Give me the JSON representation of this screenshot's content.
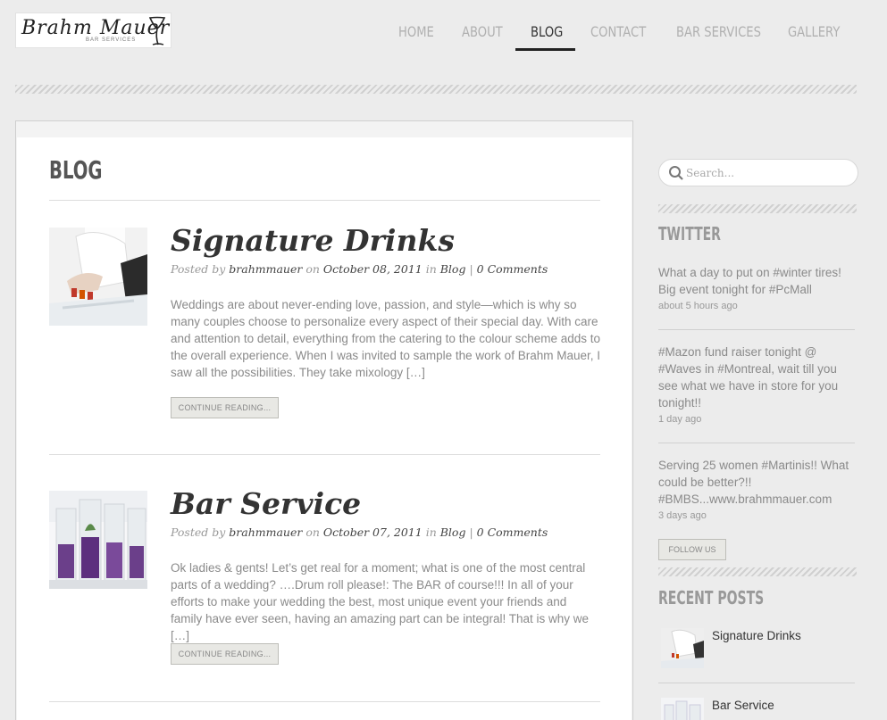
{
  "logo": {
    "script": "Brahm Mauer",
    "sub": "BAR SERVICES"
  },
  "nav": {
    "items": [
      {
        "label": "Home"
      },
      {
        "label": "About"
      },
      {
        "label": "Blog"
      },
      {
        "label": "Contact"
      },
      {
        "label": "Bar Services"
      },
      {
        "label": "Gallery"
      }
    ],
    "active": "Blog"
  },
  "page": {
    "title": "BLOG"
  },
  "posts": [
    {
      "title": "Signature Drinks",
      "meta": {
        "posted_by": "Posted by",
        "author": "brahmmauer",
        "on": "on",
        "date": "October 08, 2011",
        "in": "in",
        "category": "Blog",
        "sep": "|",
        "comments": "0 Comments"
      },
      "excerpt": "Weddings are about never-ending love, passion, and style—which is why so many couples choose to personalize every aspect of their special day.  With care and attention to detail, everything from the catering to the colour scheme adds to the overall experience. When I was invited to sample the work of Brahm Mauer, I saw all the possibilities. They take mixology […]",
      "button": "Continue Reading..."
    },
    {
      "title": "Bar Service",
      "meta": {
        "posted_by": "Posted by",
        "author": "brahmmauer",
        "on": "on",
        "date": "October 07, 2011",
        "in": "in",
        "category": "Blog",
        "sep": "|",
        "comments": "0 Comments"
      },
      "excerpt": "Ok ladies & gents! Let’s get real for a moment; what is one of the most central parts of a wedding? ….Drum roll please!: The BAR of course!!! In all of your efforts to make your wedding the best, most unique event your friends and family have ever seen, having an amazing part can be integral! That is why we […]",
      "button": "Continue Reading..."
    }
  ],
  "sidebar": {
    "search": {
      "placeholder": "Search..."
    },
    "twitter": {
      "heading": "Twitter",
      "tweets": [
        {
          "text": "What a day to put on #winter tires! Big event tonight for #PcMall",
          "time": "about 5 hours ago"
        },
        {
          "text": "#Mazon fund raiser tonight @ #Waves in #Montreal, wait till you see what we have in store for you tonight!!",
          "time": "1 day ago"
        },
        {
          "text": "Serving 25 women #Martinis!! What could be better?!! #BMBS...www.brahmmauer.com",
          "time": "3 days ago"
        }
      ],
      "follow": "Follow Us"
    },
    "recent": {
      "heading": "Recent Posts",
      "items": [
        {
          "label": "Signature Drinks"
        },
        {
          "label": "Bar Service"
        }
      ]
    }
  },
  "colors": {
    "background": "#ececec",
    "text": "#8a8a8a",
    "heading": "#333333",
    "accent": "#222222"
  }
}
